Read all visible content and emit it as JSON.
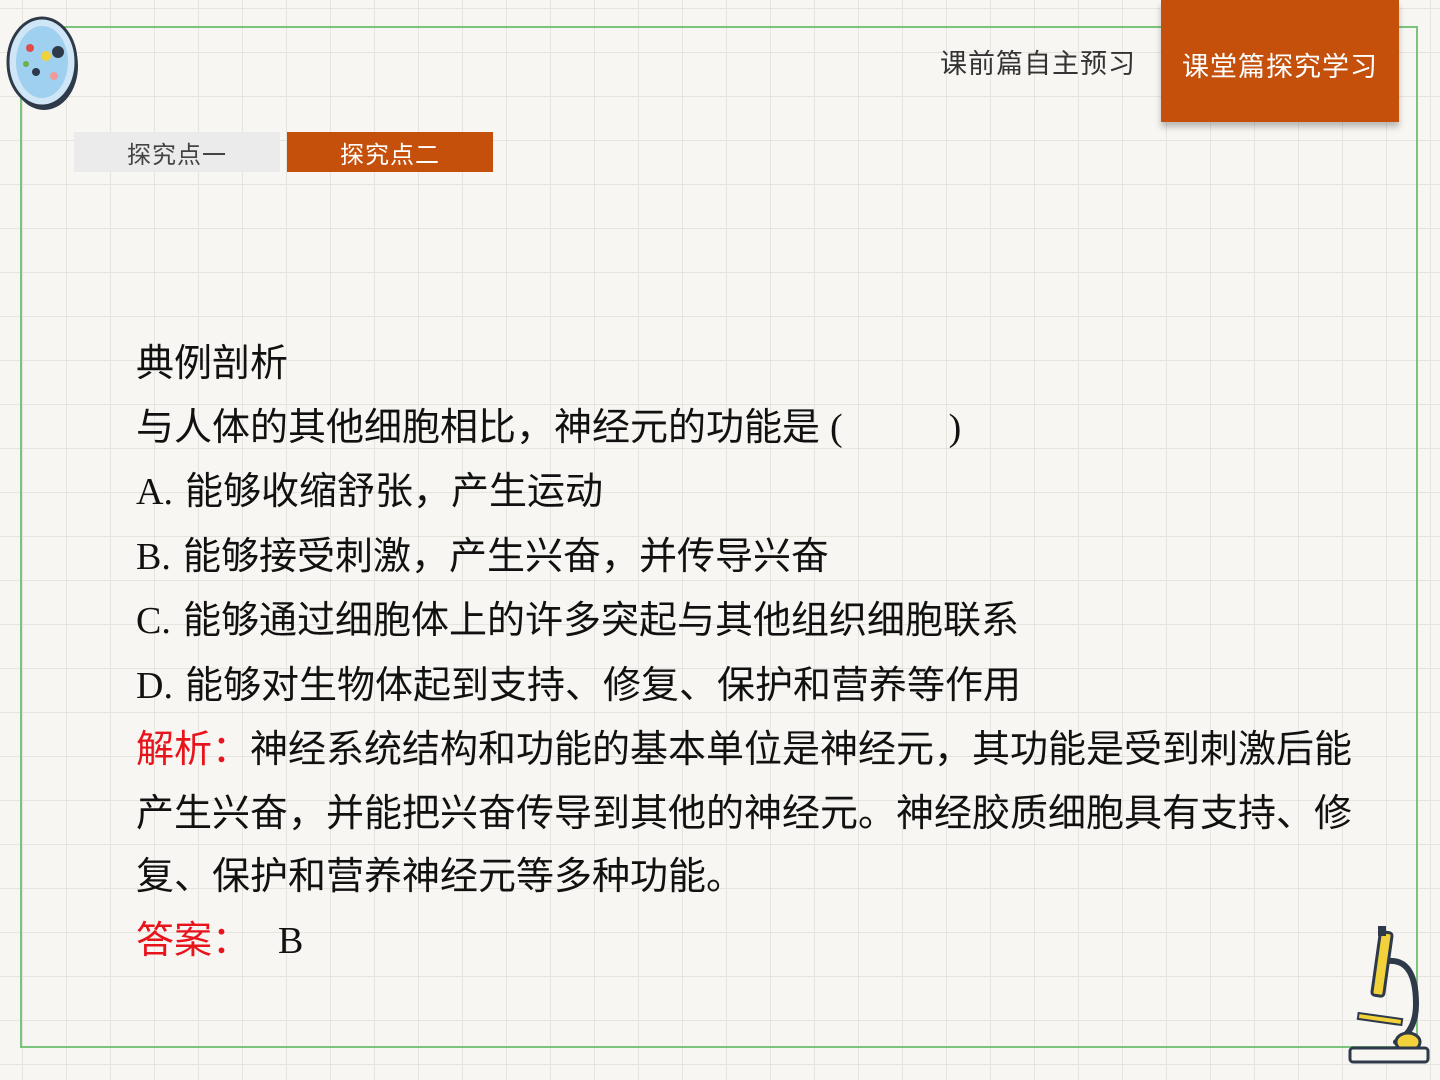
{
  "nav": {
    "prev_section": "课前篇自主预习",
    "current_section": "课堂篇探究学习"
  },
  "tabs": [
    {
      "label": "探究点一"
    },
    {
      "label": "探究点二"
    }
  ],
  "content": {
    "heading": "典例剖析",
    "question": "与人体的其他细胞相比，神经元的功能是",
    "question_paren_open": "(",
    "question_paren_close": ")",
    "options": [
      {
        "letter": "A.",
        "text": "能够收缩舒张，产生运动"
      },
      {
        "letter": "B.",
        "text": "能够接受刺激，产生兴奋，并传导兴奋"
      },
      {
        "letter": "C.",
        "text": "能够通过细胞体上的许多突起与其他组织细胞联系"
      },
      {
        "letter": "D.",
        "text": "能够对生物体起到支持、修复、保护和营养等作用"
      }
    ],
    "analysis_label": "解析：",
    "analysis_text": "神经系统结构和功能的基本单位是神经元，其功能是受到刺激后能产生兴奋，并能把兴奋传导到其他的神经元。神经胶质细胞具有支持、修复、保护和营养神经元等多种功能。",
    "answer_label": "答案：",
    "answer_value": "B"
  },
  "colors": {
    "accent": "#c4500c",
    "frame": "#7cc47c",
    "highlight": "#e8141c"
  },
  "icons": [
    "petri-dish-icon",
    "microscope-icon"
  ]
}
